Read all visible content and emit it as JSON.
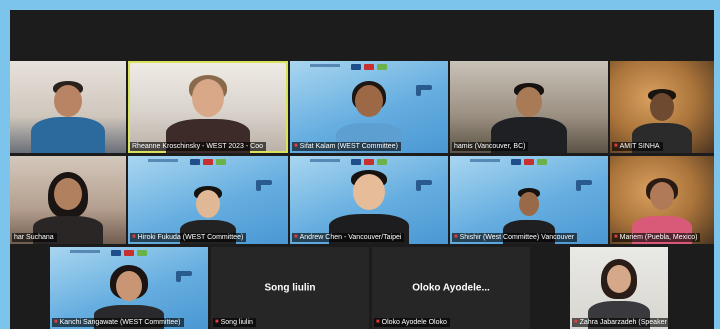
{
  "gallery": {
    "tiles": [
      {
        "name": "",
        "mic": "",
        "scene": "room1"
      },
      {
        "name": "Rheanne Kroschinsky - WEST 2023 - Coo",
        "mic": "",
        "scene": "room2",
        "active": true
      },
      {
        "name": "Sifat Kalam (WEST Committee)",
        "mic": "muted-mic-icon",
        "scene": "blue"
      },
      {
        "name": "hamis (Vancouver, BC)",
        "mic": "",
        "scene": "room3"
      },
      {
        "name": "AMIT SINHA",
        "mic": "muted-mic-icon",
        "scene": "warm"
      },
      {
        "name": "har Suchana",
        "mic": "",
        "scene": "room4"
      },
      {
        "name": "Hiroki Fukuda (WEST Committee)",
        "mic": "muted-mic-icon",
        "scene": "blue"
      },
      {
        "name": "Andrew Chen - Vancouver/Taipei",
        "mic": "muted-mic-icon",
        "scene": "blue"
      },
      {
        "name": "Shishir (West Committee) Vancouver",
        "mic": "muted-mic-icon",
        "scene": "blue"
      },
      {
        "name": "Mariem (Puebla, Mexico)",
        "mic": "muted-mic-icon",
        "scene": "warm"
      },
      {
        "name": "Kanchi Sangawate (WEST Committee)",
        "mic": "muted-mic-icon",
        "scene": "blue"
      },
      {
        "name": "Song liulin",
        "mic": "muted-mic-icon",
        "scene": "dark",
        "center": "Song liulin"
      },
      {
        "name": "Oloko Ayodele Oloko",
        "mic": "muted-mic-icon",
        "scene": "dark",
        "center": "Oloko Ayodele..."
      },
      {
        "name": "Zahra Jabarzadeh (Speaker team)",
        "mic": "muted-mic-icon",
        "scene": "wall"
      }
    ]
  },
  "colors": {
    "frame_bg": "#7cc4ec",
    "gallery_bg": "#1c1c1c",
    "active_speaker_border": "#d8e25a",
    "muted_mic": "#e33b3b"
  }
}
